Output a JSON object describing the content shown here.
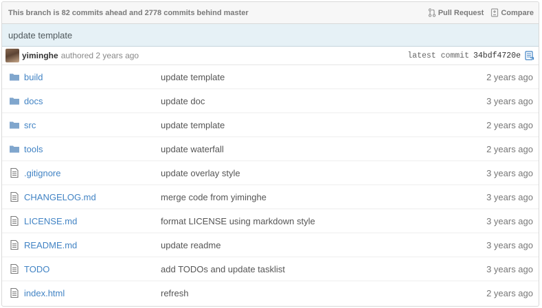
{
  "branch_bar": {
    "status": "This branch is 82 commits ahead and 2778 commits behind master",
    "pull_request_label": "Pull Request",
    "compare_label": "Compare"
  },
  "commit": {
    "message": "update template",
    "author": "yiminghe",
    "authored_text": "authored 2 years ago",
    "latest_label": "latest commit",
    "sha": "34bdf4720e"
  },
  "files": [
    {
      "name": "build",
      "type": "folder",
      "message": "update template",
      "age": "2 years ago"
    },
    {
      "name": "docs",
      "type": "folder",
      "message": "update doc",
      "age": "3 years ago"
    },
    {
      "name": "src",
      "type": "folder",
      "message": "update template",
      "age": "2 years ago"
    },
    {
      "name": "tools",
      "type": "folder",
      "message": "update waterfall",
      "age": "2 years ago"
    },
    {
      "name": ".gitignore",
      "type": "file",
      "message": "update overlay style",
      "age": "3 years ago"
    },
    {
      "name": "CHANGELOG.md",
      "type": "file",
      "message": "merge code from yiminghe",
      "age": "3 years ago"
    },
    {
      "name": "LICENSE.md",
      "type": "file",
      "message": "format LICENSE using markdown style",
      "age": "3 years ago"
    },
    {
      "name": "README.md",
      "type": "file",
      "message": "update readme",
      "age": "3 years ago"
    },
    {
      "name": "TODO",
      "type": "file",
      "message": "add TODOs and update tasklist",
      "age": "3 years ago"
    },
    {
      "name": "index.html",
      "type": "file",
      "message": "refresh",
      "age": "2 years ago"
    }
  ],
  "colors": {
    "link": "#4183c4",
    "folder_icon": "#80a6cd",
    "commit_bar_bg": "#e6f1f6"
  }
}
